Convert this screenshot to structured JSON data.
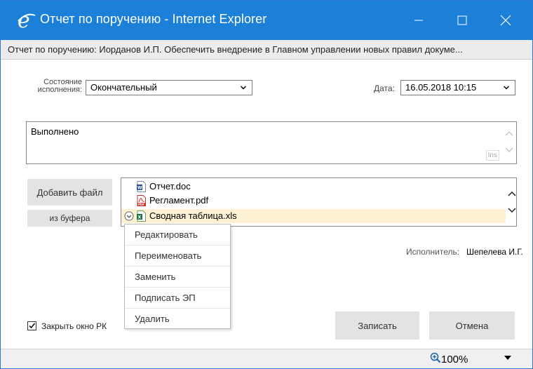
{
  "window": {
    "title": "Отчет по поручению - Internet Explorer",
    "subtitle": "Отчет по поручению: Иорданов И.П. Обеспечить внедрение в Главном управлении новых правил докуме...",
    "brand_color": "#1c7fd8"
  },
  "form": {
    "state_label": "Состояние исполнения:",
    "state_value": "Окончательный",
    "date_label": "Дата:",
    "date_value": "16.05.2018 10:15",
    "comment_text": "Выполнено",
    "ins_label": "Ins",
    "add_file_label": "Добавить файл",
    "from_buffer_label": "из буфера",
    "executor_label": "Исполнитель:",
    "executor_value": "Шепелева И.Г.",
    "close_rk_label": "Закрыть окно РК",
    "close_rk_checked": true,
    "save_label": "Записать",
    "cancel_label": "Отмена"
  },
  "files": [
    {
      "name": "Отчет.doc",
      "type": "doc",
      "icon": "word-icon"
    },
    {
      "name": "Регламент.pdf",
      "type": "pdf",
      "icon": "pdf-icon"
    },
    {
      "name": "Сводная таблица.xls",
      "type": "xls",
      "icon": "excel-icon",
      "selected": true
    }
  ],
  "context_menu": [
    "Редактировать",
    "Переименовать",
    "Заменить",
    "Подписать ЭП",
    "Удалить"
  ],
  "status": {
    "zoom": "100%"
  }
}
